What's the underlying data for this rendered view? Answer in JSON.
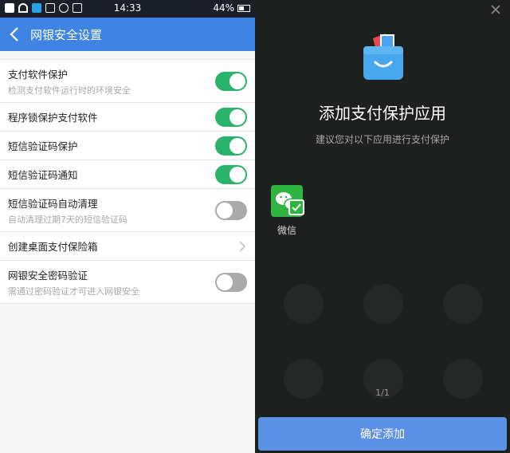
{
  "status_bar": {
    "time": "14:33",
    "battery": "44%"
  },
  "header": {
    "title": "网银安全设置"
  },
  "settings": [
    {
      "label": "支付软件保护",
      "sub": "检测支付软件运行时的环境安全",
      "type": "toggle",
      "on": true
    },
    {
      "label": "程序锁保护支付软件",
      "sub": "",
      "type": "toggle",
      "on": true
    },
    {
      "label": "短信验证码保护",
      "sub": "",
      "type": "toggle",
      "on": true
    },
    {
      "label": "短信验证码通知",
      "sub": "",
      "type": "toggle",
      "on": true
    },
    {
      "label": "短信验证码自动清理",
      "sub": "自动清理过期7天的短信验证码",
      "type": "toggle",
      "on": false
    },
    {
      "label": "创建桌面支付保险箱",
      "sub": "",
      "type": "link"
    },
    {
      "label": "网银安全密码验证",
      "sub": "需通过密码验证才可进入网银安全",
      "type": "toggle",
      "on": false
    }
  ],
  "dialog": {
    "title": "添加支付保护应用",
    "subtitle": "建议您对以下应用进行支付保护",
    "app": {
      "name": "微信",
      "checked": true
    },
    "pager": "1/1",
    "confirm_label": "确定添加"
  },
  "colors": {
    "accent": "#3f83e3",
    "toggle_on": "#2ab36a",
    "toggle_off": "#aaaaaa",
    "wechat": "#2fb341",
    "button": "#5b90e4"
  }
}
